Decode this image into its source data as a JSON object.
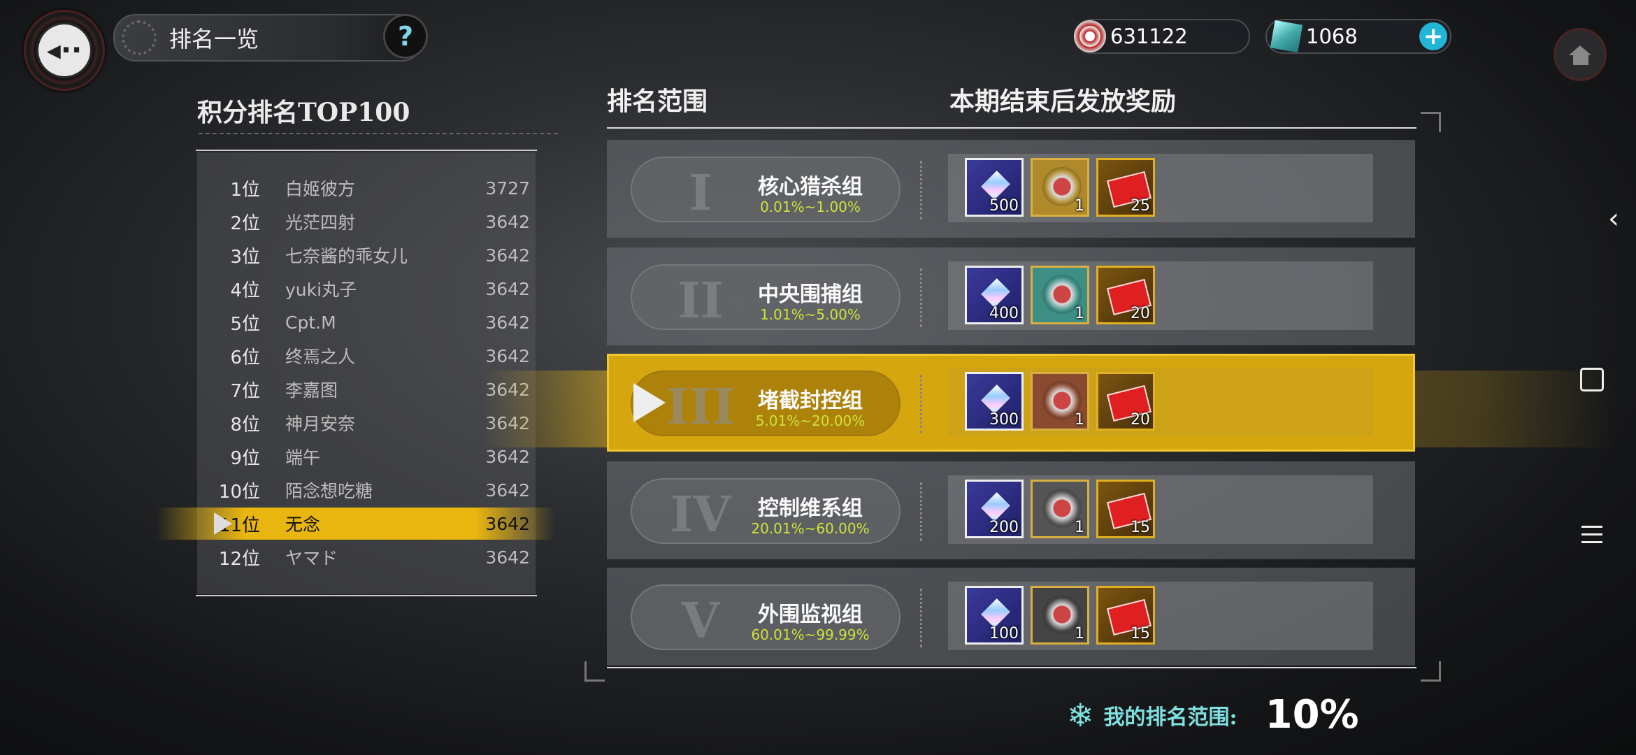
{
  "header": {
    "title": "排名一览",
    "help_label": "?",
    "currency1": {
      "value": "631122",
      "icon": "coin-icon"
    },
    "currency2": {
      "value": "1068",
      "icon": "cube-icon"
    },
    "plus_label": "+"
  },
  "left": {
    "title": "积分排名TOP100",
    "rows": [
      {
        "rank": "1位",
        "name": "白姬彼方",
        "score": "3727"
      },
      {
        "rank": "2位",
        "name": "光茫四射",
        "score": "3642"
      },
      {
        "rank": "3位",
        "name": "七奈酱的乖女儿",
        "score": "3642"
      },
      {
        "rank": "4位",
        "name": "yuki丸子",
        "score": "3642"
      },
      {
        "rank": "5位",
        "name": "Cpt.M",
        "score": "3642"
      },
      {
        "rank": "6位",
        "name": "终焉之人",
        "score": "3642"
      },
      {
        "rank": "7位",
        "name": "李嘉图",
        "score": "3642"
      },
      {
        "rank": "8位",
        "name": "神月安奈",
        "score": "3642"
      },
      {
        "rank": "9位",
        "name": "端午",
        "score": "3642"
      },
      {
        "rank": "10位",
        "name": "陌念想吃糖",
        "score": "3642"
      },
      {
        "rank": "11位",
        "name": "无念",
        "score": "3642"
      },
      {
        "rank": "12位",
        "name": "ヤマド",
        "score": "3642"
      }
    ],
    "selected_index": 10
  },
  "right": {
    "col1_header": "排名范围",
    "col2_header": "本期结束后发放奖励",
    "tiers": [
      {
        "roman": "I",
        "name": "核心猎杀组",
        "range": "0.01%~1.00%",
        "rewards": [
          "500",
          "1",
          "25"
        ],
        "medal_color": "#b08a2a"
      },
      {
        "roman": "II",
        "name": "中央围捕组",
        "range": "1.01%~5.00%",
        "rewards": [
          "400",
          "1",
          "20"
        ],
        "medal_color": "#3d8f86"
      },
      {
        "roman": "III",
        "name": "堵截封控组",
        "range": "5.01%~20.00%",
        "rewards": [
          "300",
          "1",
          "20"
        ],
        "medal_color": "#8a4a30"
      },
      {
        "roman": "IV",
        "name": "控制维系组",
        "range": "20.01%~60.00%",
        "rewards": [
          "200",
          "1",
          "15"
        ],
        "medal_color": "#555555"
      },
      {
        "roman": "V",
        "name": "外围监视组",
        "range": "60.01%~99.99%",
        "rewards": [
          "100",
          "1",
          "15"
        ],
        "medal_color": "#444444"
      }
    ],
    "active_tier": 2
  },
  "footer": {
    "my_rank_label": "我的排名范围:",
    "my_rank_value": "10%"
  }
}
